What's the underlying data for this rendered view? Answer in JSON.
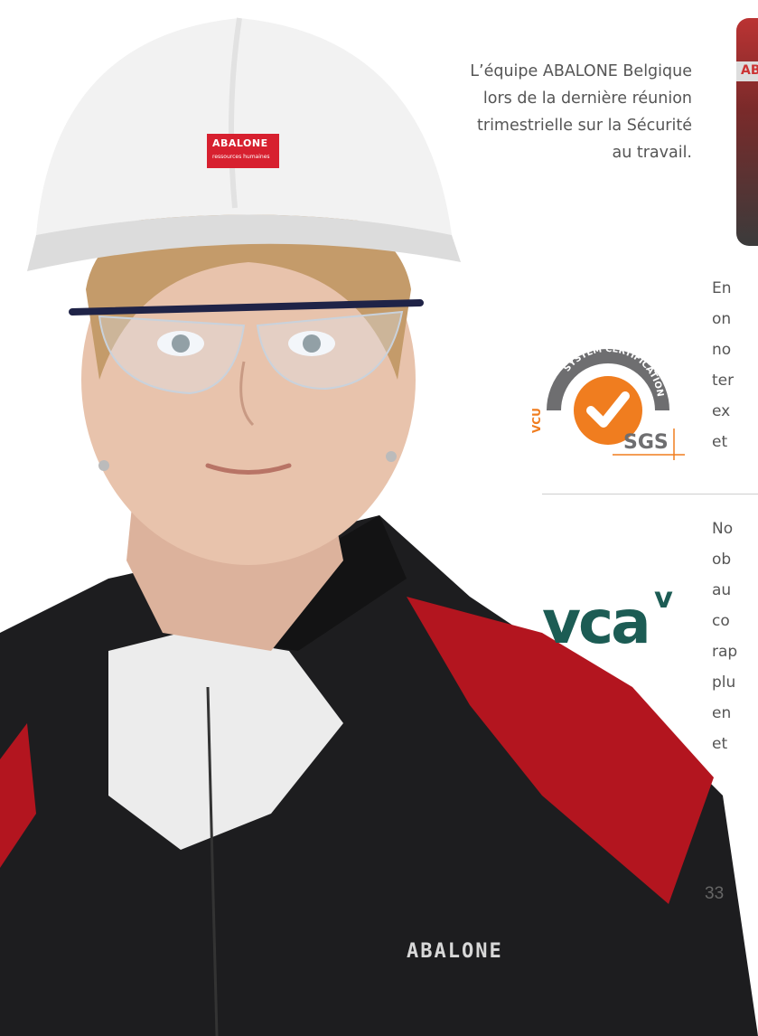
{
  "caption": {
    "lines": [
      "L’équipe ABALONE Belgique",
      "lors de la dernière réunion",
      "trimestrielle sur la Sécurité",
      "au travail."
    ]
  },
  "para1": [
    "En",
    "on",
    "no",
    "ter",
    "ex",
    "et"
  ],
  "para2": [
    "No",
    "ob",
    "au",
    "co",
    "rap",
    "plu",
    "en",
    "et"
  ],
  "sgs": {
    "arc_text": "SYSTEM CERTIFICATION",
    "side_text": "VCU",
    "brand": "SGS"
  },
  "vca": {
    "text": "vca",
    "check": "v"
  },
  "page_number": "33",
  "jacket_brand": "ABALONE",
  "helmet_brand": {
    "name": "ABALONE",
    "sub": "ressources humaines"
  },
  "thumb_brand": "ABA",
  "colors": {
    "accent_red": "#d7202f",
    "sgs_orange": "#f07d1f",
    "vca_green": "#1c5c54"
  }
}
